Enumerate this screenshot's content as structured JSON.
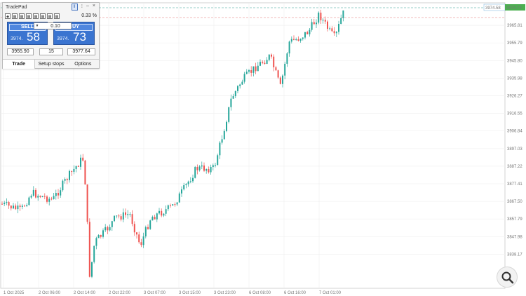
{
  "tradepad": {
    "title": "TradePad",
    "spread": "0.33 %",
    "sell": {
      "label": "SELL",
      "price_small": "3974.",
      "price_big": "58"
    },
    "buy": {
      "label": "BUY",
      "price_small": "3974.",
      "price_big": "73"
    },
    "volume": "0.10",
    "stop_loss": "3955.90",
    "points": "15",
    "take_profit": "3977.64",
    "tabs": [
      "Trade",
      "Setup stops",
      "Options"
    ]
  },
  "chart": {
    "current_price_label": "3974.58",
    "ask_price_label": "3974.73",
    "price_ticks": [
      "3974.58",
      "3965.81",
      "3955.79",
      "3945.80",
      "3935.98",
      "3926.27",
      "3916.55",
      "3906.84",
      "3897.03",
      "3887.22",
      "3877.41",
      "3867.50",
      "3857.79",
      "3847.98",
      "3838.17"
    ],
    "time_ticks": [
      "1 Oct 2025",
      "2 Oct 06:00",
      "2 Oct 14:00",
      "2 Oct 22:00",
      "3 Oct 07:00",
      "3 Oct 15:00",
      "3 Oct 23:00",
      "6 Oct 08:00",
      "6 Oct 16:00",
      "7 Oct 01:00"
    ],
    "colors": {
      "bull": "#26a69a",
      "bear": "#ef5350",
      "price_line": "#2b9c8f",
      "ask_line": "#e57373"
    }
  },
  "icons": {
    "zoom": "magnifier-icon",
    "pin": "pin-icon"
  }
}
